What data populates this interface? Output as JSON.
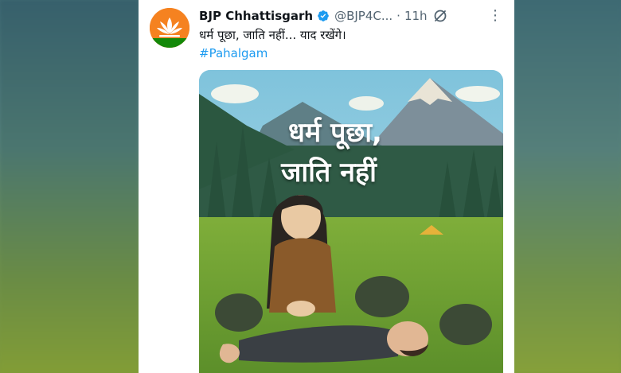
{
  "post": {
    "author_name": "BJP Chhattisgarh",
    "handle": "@BJP4C...",
    "separator": "·",
    "time": "11h",
    "text": "धर्म पूछा, जाति नहीं... याद रखेंगे।",
    "hashtag": "#Pahalgam",
    "more_glyph": "⋮"
  },
  "media": {
    "caption_line1": "धर्म पूछा,",
    "caption_line2": "जाति नहीं"
  },
  "colors": {
    "verified": "#1d9bf0",
    "hashtag": "#1d9bf0",
    "avatar_bg": "#f58220"
  },
  "icons": {
    "verified": "verified-badge-icon",
    "grok": "grok-icon",
    "more": "more-icon"
  }
}
